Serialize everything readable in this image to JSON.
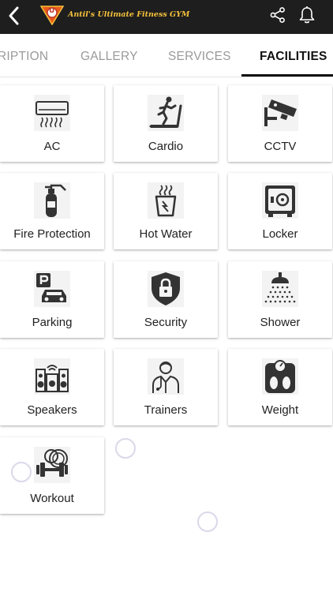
{
  "header": {
    "brand_name": "Antil's Ultimate Fitness GYM",
    "logo_text": "U",
    "bar_color": "#1e1e1e",
    "brand_color": "#f5c13b"
  },
  "tabs": [
    {
      "label": "RIPTION",
      "active": false
    },
    {
      "label": "GALLERY",
      "active": false
    },
    {
      "label": "SERVICES",
      "active": false
    },
    {
      "label": "FACILITIES",
      "active": true
    }
  ],
  "facilities": [
    {
      "label": "AC",
      "icon": "ac-icon"
    },
    {
      "label": "Cardio",
      "icon": "treadmill-icon"
    },
    {
      "label": "CCTV",
      "icon": "cctv-icon"
    },
    {
      "label": "Fire Protection",
      "icon": "fire-extinguisher-icon"
    },
    {
      "label": "Hot Water",
      "icon": "hot-water-icon"
    },
    {
      "label": "Locker",
      "icon": "locker-icon"
    },
    {
      "label": "Parking",
      "icon": "parking-icon"
    },
    {
      "label": "Security",
      "icon": "security-lock-icon"
    },
    {
      "label": "Shower",
      "icon": "shower-icon"
    },
    {
      "label": "Speakers",
      "icon": "speakers-icon"
    },
    {
      "label": "Trainers",
      "icon": "trainer-icon"
    },
    {
      "label": "Weight",
      "icon": "weight-scale-icon"
    },
    {
      "label": "Workout",
      "icon": "dumbbell-icon"
    }
  ]
}
